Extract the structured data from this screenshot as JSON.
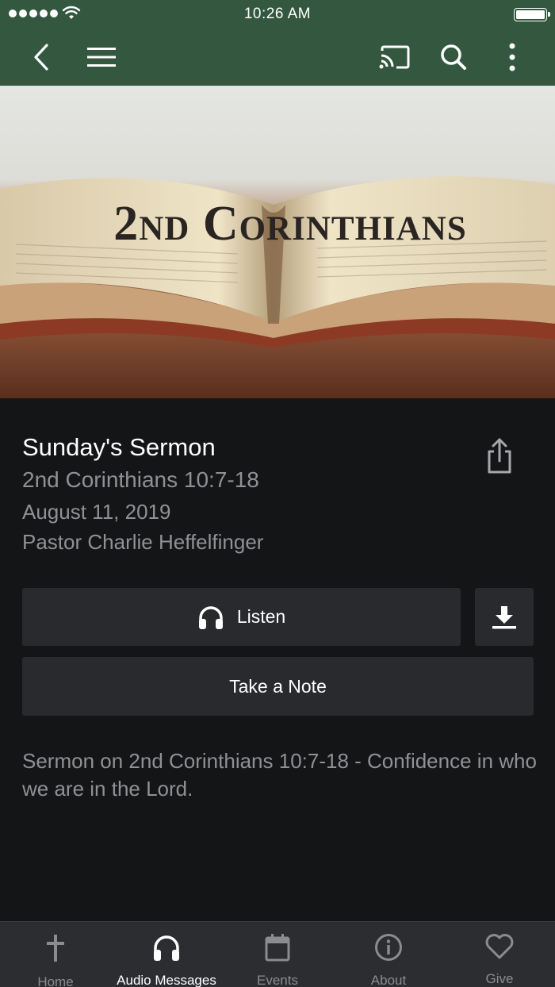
{
  "status_bar": {
    "time": "10:26 AM"
  },
  "nav": {
    "icons": [
      "back-icon",
      "menu-icon",
      "cast-icon",
      "search-icon",
      "more-vertical-icon"
    ]
  },
  "hero": {
    "title_text": "2nd Corinthians"
  },
  "sermon": {
    "title": "Sunday's Sermon",
    "passage": "2nd Corinthians 10:7-18",
    "date": "August 11, 2019",
    "speaker": "Pastor Charlie Heffelfinger",
    "description": "Sermon on 2nd Corinthians 10:7-18 - Confidence in who we are in the Lord."
  },
  "actions": {
    "listen_label": "Listen",
    "note_label": "Take a Note"
  },
  "tabs": [
    {
      "label": "Home",
      "icon": "cross-icon",
      "active": false
    },
    {
      "label": "Audio Messages",
      "icon": "headphones-icon",
      "active": true
    },
    {
      "label": "Events",
      "icon": "calendar-icon",
      "active": false
    },
    {
      "label": "About",
      "icon": "info-icon",
      "active": false
    },
    {
      "label": "Give",
      "icon": "heart-icon",
      "active": false
    }
  ],
  "colors": {
    "brand_green": "#33573f",
    "background": "#141517",
    "button_bg": "#282a2d",
    "muted_text": "#8f9195",
    "tabbar_bg": "#2c2d30"
  }
}
